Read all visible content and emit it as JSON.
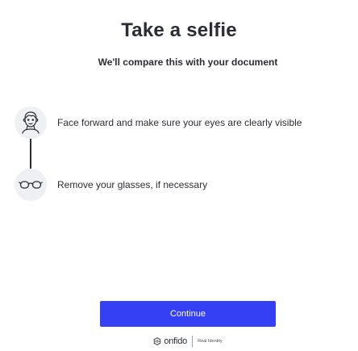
{
  "header": {
    "title": "Take a selfie",
    "subtitle": "We'll compare this with your document"
  },
  "steps": [
    {
      "icon": "face-icon",
      "text": "Face forward and make sure your eyes are clearly visible"
    },
    {
      "icon": "glasses-icon",
      "text": "Remove your glasses, if necessary"
    }
  ],
  "actions": {
    "continue_label": "Continue"
  },
  "footer": {
    "brand": "onfido",
    "tagline": "Real Identity"
  },
  "colors": {
    "accent": "#353ff4",
    "text": "#2b2d33",
    "icon_bg": "#eef0f4"
  }
}
